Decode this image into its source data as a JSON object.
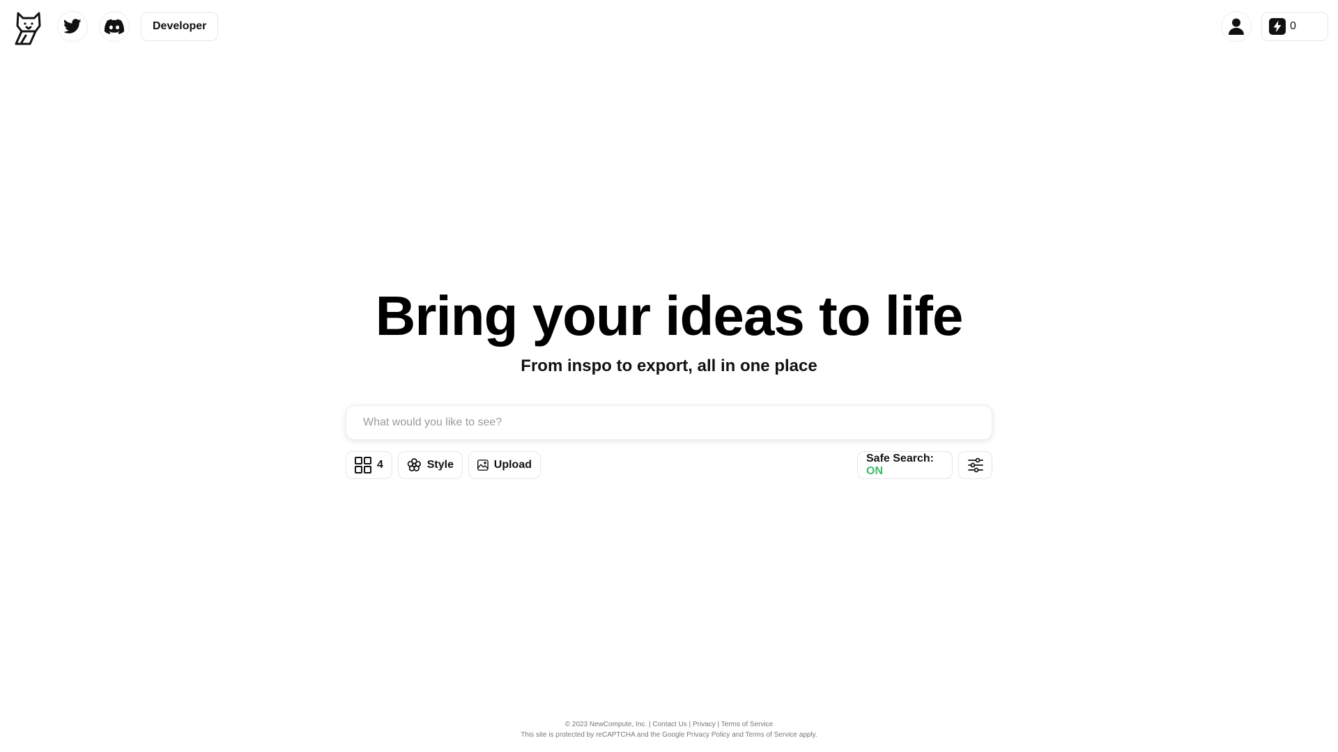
{
  "header": {
    "logo_icon": "fox-logo-icon",
    "twitter_icon": "twitter-icon",
    "discord_icon": "discord-icon",
    "developer_label": "Developer",
    "account_icon": "user-icon",
    "credits_icon": "lightning-icon",
    "credits_count": "0"
  },
  "hero": {
    "title": "Bring your ideas to life",
    "subtitle": "From inspo to export, all in one place"
  },
  "search": {
    "placeholder": "What would you like to see?",
    "value": ""
  },
  "options": {
    "count_icon": "grid-icon",
    "count_value": "4",
    "style_icon": "flower-icon",
    "style_label": "Style",
    "upload_icon": "image-icon",
    "upload_label": "Upload",
    "safe_search_label": "Safe Search:",
    "safe_search_state": "ON",
    "filter_icon": "sliders-icon"
  },
  "colors": {
    "accent_green": "#3dbb6a",
    "text": "#111111",
    "border": "#e6e6e6"
  },
  "footer": {
    "copyright": "© 2023 NewCompute, Inc.",
    "sep": "|",
    "contact": "Contact Us",
    "privacy": "Privacy",
    "terms": "Terms of Service",
    "recaptcha_prefix": "This site is protected by reCAPTCHA and the Google",
    "privacy_policy": "Privacy Policy",
    "and": "and",
    "terms_of_service": "Terms of Service",
    "apply": "apply."
  }
}
